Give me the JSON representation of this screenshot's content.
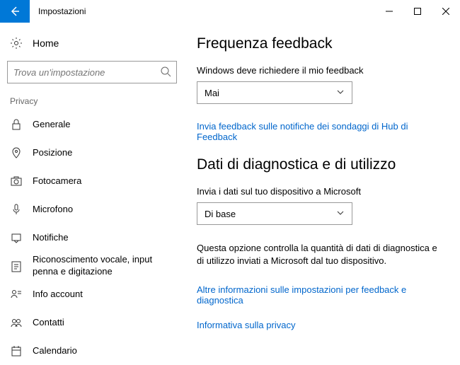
{
  "window": {
    "title": "Impostazioni"
  },
  "sidebar": {
    "home": "Home",
    "search_placeholder": "Trova un'impostazione",
    "section": "Privacy",
    "items": [
      {
        "label": "Generale"
      },
      {
        "label": "Posizione"
      },
      {
        "label": "Fotocamera"
      },
      {
        "label": "Microfono"
      },
      {
        "label": "Notifiche"
      },
      {
        "label": "Riconoscimento vocale, input penna e digitazione"
      },
      {
        "label": "Info account"
      },
      {
        "label": "Contatti"
      },
      {
        "label": "Calendario"
      }
    ]
  },
  "main": {
    "feedback": {
      "heading": "Frequenza feedback",
      "label": "Windows deve richiedere il mio feedback",
      "value": "Mai",
      "link": "Invia feedback sulle notifiche dei sondaggi di Hub di Feedback"
    },
    "diag": {
      "heading": "Dati di diagnostica e di utilizzo",
      "label": "Invia i dati sul tuo dispositivo a Microsoft",
      "value": "Di base",
      "desc": "Questa opzione controlla la quantità di dati di diagnostica e di utilizzo inviati a Microsoft dal tuo dispositivo.",
      "link1": "Altre informazioni sulle impostazioni per feedback e diagnostica",
      "link2": "Informativa sulla privacy"
    }
  }
}
